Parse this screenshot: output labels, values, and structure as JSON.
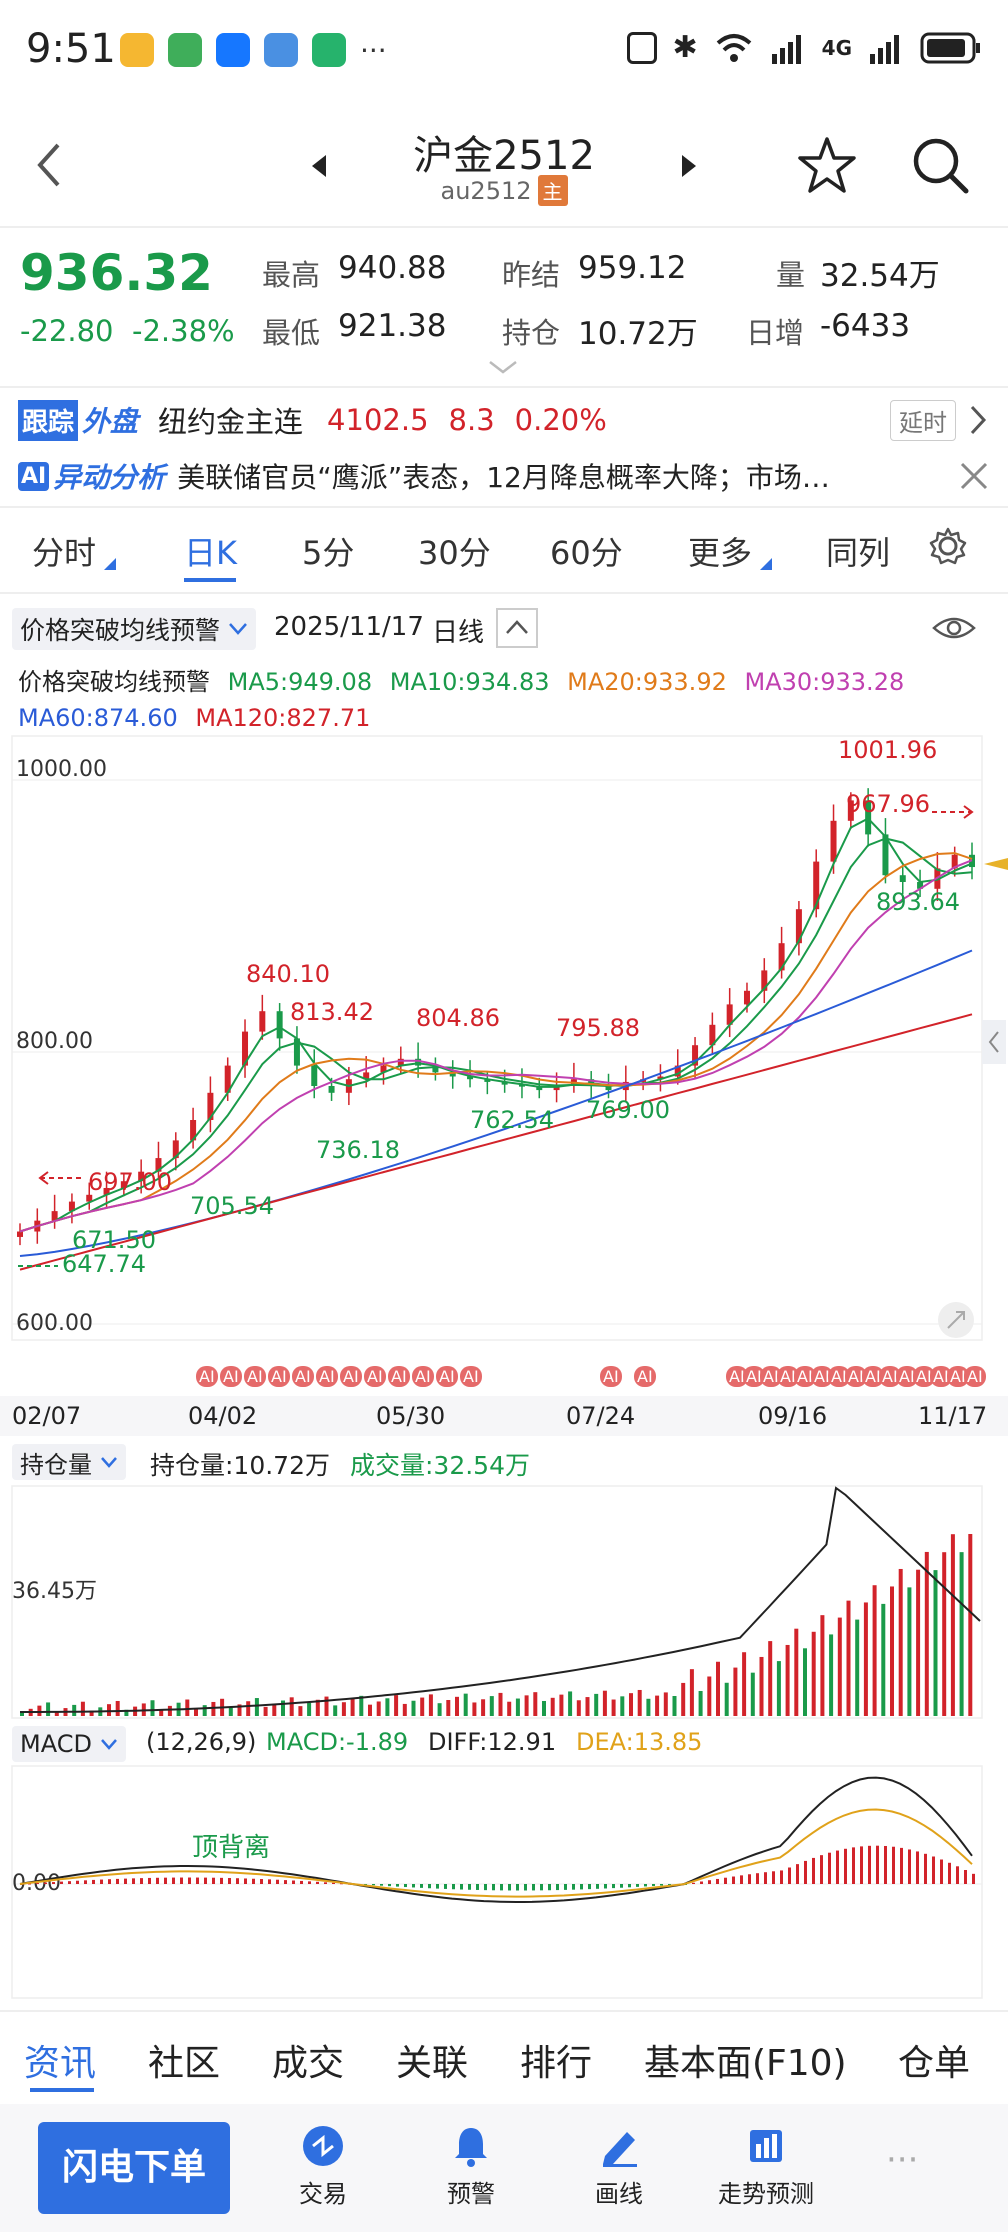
{
  "status_bar": {
    "time": "9:51",
    "network": "4G",
    "icons": [
      "weibo-icon",
      "leaf-app-icon",
      "alipay-icon",
      "chart-app-icon",
      "shield-app-icon",
      "more-dots-icon",
      "nfc-icon",
      "bluetooth-icon",
      "wifi-icon",
      "signal-icon",
      "battery-icon"
    ]
  },
  "header": {
    "title": "沪金2512",
    "code": "au2512",
    "badge": "主"
  },
  "quote": {
    "price": "936.32",
    "change": "-22.80",
    "change_pct": "-2.38%",
    "high_label": "最高",
    "high": "940.88",
    "low_label": "最低",
    "low": "921.38",
    "prev_label": "昨结",
    "prev": "959.12",
    "oi_label": "持仓",
    "oi": "10.72万",
    "vol_label": "量",
    "vol": "32.54万",
    "daily_label": "日增",
    "daily": "-6433"
  },
  "tracker": {
    "tag1": "跟踪",
    "tag2": "外盘",
    "name": "纽约金主连",
    "price": "4102.5",
    "change": "8.3",
    "pct": "0.20%",
    "delay": "延时"
  },
  "ai": {
    "tag": "AI",
    "label": "异动分析",
    "text": "美联储官员“鹰派”表态，12月降息概率大降；市场…"
  },
  "tabs": [
    {
      "label": "分时"
    },
    {
      "label": "日K"
    },
    {
      "label": "5分"
    },
    {
      "label": "30分"
    },
    {
      "label": "60分"
    },
    {
      "label": "更多"
    },
    {
      "label": "同列"
    }
  ],
  "chart_header": {
    "indicator": "价格突破均线预警",
    "date": "2025/11/17",
    "period": "日线"
  },
  "ma": {
    "title": "价格突破均线预警",
    "ma5": "MA5:949.08",
    "ma10": "MA10:934.83",
    "ma20": "MA20:933.92",
    "ma30": "MA30:933.28",
    "ma60": "MA60:874.60",
    "ma120": "MA120:827.71"
  },
  "colors": {
    "up": "#d2232a",
    "down": "#1a9a4a",
    "ma5": "#1a9a4a",
    "ma10": "#1a9a4a",
    "ma20": "#e07b1a",
    "ma30": "#c040b0",
    "ma60": "#2a5bd7",
    "ma120": "#d2232a"
  },
  "y_axis": {
    "top": "1000.00",
    "mid": "800.00",
    "bottom": "600.00"
  },
  "annotations": [
    "1001.96",
    "967.96",
    "893.64",
    "840.10",
    "813.42",
    "804.86",
    "795.88",
    "762.54",
    "769.00",
    "736.18",
    "697.00",
    "705.54",
    "671.50",
    "647.74"
  ],
  "ai_badges": [
    "AI",
    "AI",
    "AI",
    "AI",
    "AI",
    "AI",
    "AI",
    "AI",
    "AI",
    "AI",
    "AI",
    "AI",
    "AI",
    "AI",
    "AI",
    "AI",
    "AI",
    "AI",
    "AI",
    "AI",
    "AI",
    "AI",
    "AI",
    "AI",
    "AI",
    "AI",
    "AI",
    "AI",
    "AI"
  ],
  "x_axis": [
    "02/07",
    "04/02",
    "05/30",
    "07/24",
    "09/16",
    "11/17"
  ],
  "volume": {
    "selector": "持仓量",
    "oi_text": "持仓量:10.72万",
    "vol_text": "成交量:32.54万",
    "ylabel": "36.45万"
  },
  "macd": {
    "selector": "MACD",
    "params": "(12,26,9)",
    "macd": "MACD:-1.89",
    "diff": "DIFF:12.91",
    "dea": "DEA:13.85",
    "zero": "0.00",
    "note": "顶背离"
  },
  "bottom_tabs": [
    "资讯",
    "社区",
    "成交",
    "关联",
    "排行",
    "基本面(F10)",
    "仓单"
  ],
  "nav": {
    "action": "闪电下单",
    "items": [
      "交易",
      "预警",
      "画线",
      "走势预测"
    ]
  },
  "chart_data": {
    "type": "line",
    "title": "",
    "x_ticks": [
      "02/07",
      "04/02",
      "05/30",
      "07/24",
      "09/16",
      "11/17"
    ],
    "ylim": [
      600,
      1000
    ],
    "close_series": [
      668,
      676,
      683,
      690,
      695,
      700,
      705,
      712,
      722,
      735,
      750,
      770,
      790,
      815,
      830,
      810,
      790,
      775,
      770,
      780,
      785,
      790,
      795,
      790,
      785,
      782,
      780,
      778,
      776,
      775,
      772,
      776,
      780,
      775,
      772,
      778,
      780,
      782,
      790,
      805,
      820,
      835,
      845,
      860,
      880,
      905,
      940,
      970,
      985,
      960,
      930,
      925,
      920,
      935,
      945,
      936
    ],
    "series": [
      {
        "name": "MA5",
        "last": 949.08
      },
      {
        "name": "MA10",
        "last": 934.83
      },
      {
        "name": "MA20",
        "last": 933.92
      },
      {
        "name": "MA30",
        "last": 933.28
      },
      {
        "name": "MA60",
        "last": 874.6
      },
      {
        "name": "MA120",
        "last": 827.71
      }
    ]
  }
}
